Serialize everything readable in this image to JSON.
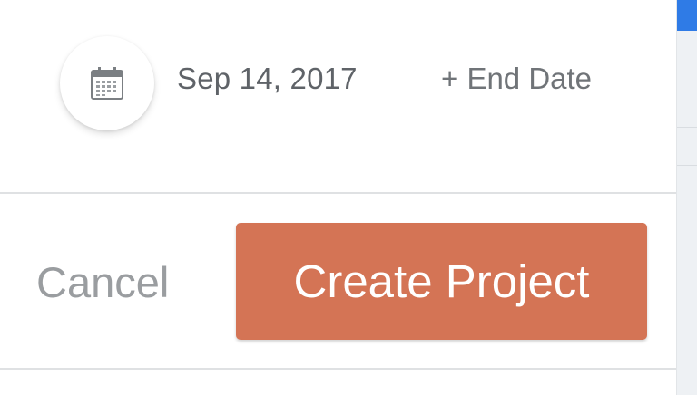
{
  "date_row": {
    "start_date": "Sep 14, 2017",
    "end_date_link": "+ End Date",
    "calendar_icon": "calendar-icon"
  },
  "actions": {
    "cancel_label": "Cancel",
    "create_label": "Create Project"
  },
  "colors": {
    "primary_button": "#d47455",
    "accent_blue": "#2f7be6",
    "muted_text": "#5f6368",
    "cancel_text": "#9a9da0"
  }
}
